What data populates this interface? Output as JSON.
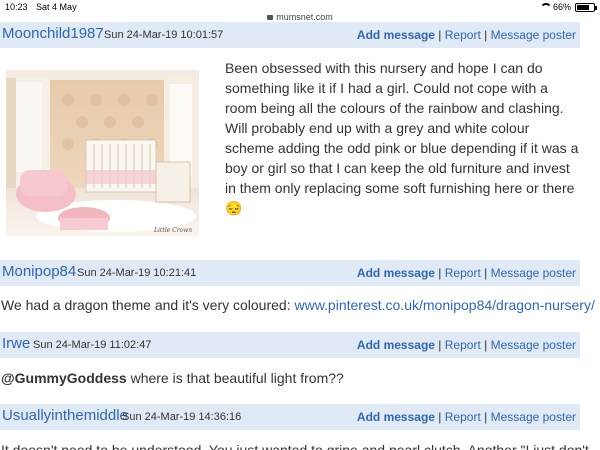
{
  "statusbar": {
    "time": "10:23",
    "date": "Sat 4 May",
    "url": "mumsnet.com",
    "battery": "66%",
    "battery_level": 0.66
  },
  "actions": {
    "add_message": "Add message",
    "report": "Report",
    "message_poster": "Message poster",
    "sep": "|"
  },
  "posts": [
    {
      "author": "Moonchild1987",
      "date": "Sun 24-Mar-19 10:01:57",
      "text": "Been obsessed with this nursery and hope I can do something like it if I had a girl. Could not cope with a room being all the colours of the rainbow and clashing. Will probably end up with a grey and white colour scheme adding the odd pink or blue depending if it was a boy or girl so that I can keep the old furniture and invest in them only replacing some soft furnishing here or there",
      "emoji": "😔",
      "image_signature": "Little Crown"
    },
    {
      "author": "Monipop84",
      "date": "Sun 24-Mar-19 10:21:41",
      "text": "We had a dragon theme and it's very coloured:",
      "link": "www.pinterest.co.uk/monipop84/dragon-nursery/"
    },
    {
      "author": "Irwe",
      "date": "Sun 24-Mar-19 11:02:47",
      "mention": "@GummyGoddess",
      "text": "where is that beautiful light from??"
    },
    {
      "author": "Usuallyinthemiddle",
      "date": "Sun 24-Mar-19 14:36:16",
      "text": "It doesn't need to be understood. You just wanted to gripe and pearl clutch. Another \"I just don't"
    }
  ]
}
